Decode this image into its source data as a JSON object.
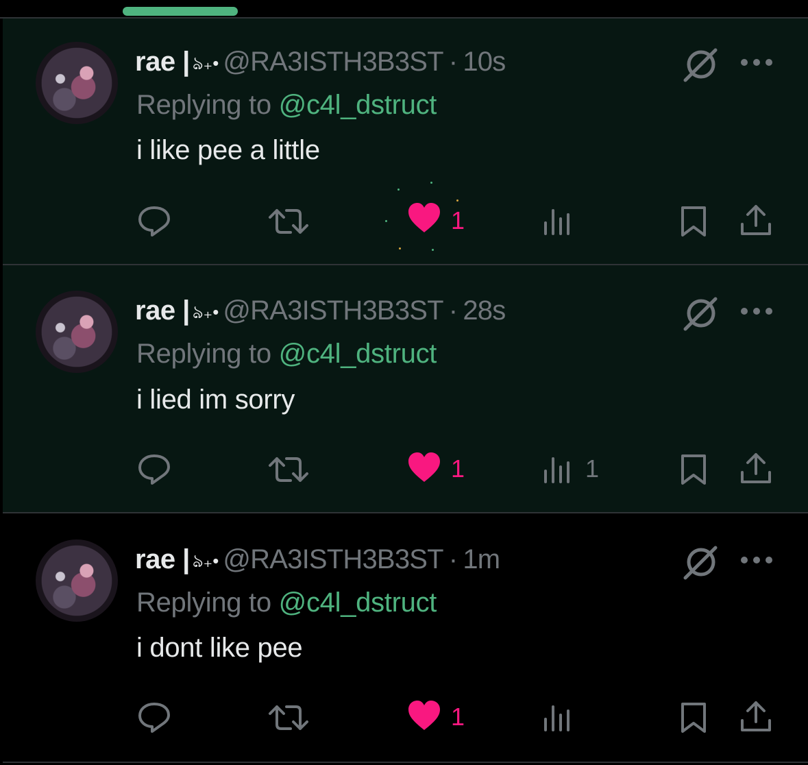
{
  "colors": {
    "accent": "#4fb37f",
    "like": "#f91880",
    "muted": "#71767b",
    "text": "#e7e9ea",
    "highlight_bg": "#071712",
    "divider": "#2f3336"
  },
  "tweets": [
    {
      "display_name": "rae |",
      "name_decoration": "ঌ₊•",
      "handle": "@RA3ISTH3B3ST",
      "separator": "·",
      "time": "10s",
      "replying_prefix": "Replying to",
      "replying_to": "@c4l_dstruct",
      "text": "i like pee a little",
      "likes": "1",
      "views": "",
      "icons": [
        "reply-icon",
        "retweet-icon",
        "heart-icon",
        "views-icon",
        "bookmark-icon",
        "share-icon",
        "grok-icon",
        "more-icon"
      ]
    },
    {
      "display_name": "rae |",
      "name_decoration": "ঌ₊•",
      "handle": "@RA3ISTH3B3ST",
      "separator": "·",
      "time": "28s",
      "replying_prefix": "Replying to",
      "replying_to": "@c4l_dstruct",
      "text": "i lied im sorry",
      "likes": "1",
      "views": "1",
      "icons": [
        "reply-icon",
        "retweet-icon",
        "heart-icon",
        "views-icon",
        "bookmark-icon",
        "share-icon",
        "grok-icon",
        "more-icon"
      ]
    },
    {
      "display_name": "rae |",
      "name_decoration": "ঌ₊•",
      "handle": "@RA3ISTH3B3ST",
      "separator": "·",
      "time": "1m",
      "replying_prefix": "Replying to",
      "replying_to": "@c4l_dstruct",
      "text": "i dont like pee",
      "likes": "1",
      "views": "",
      "icons": [
        "reply-icon",
        "retweet-icon",
        "heart-icon",
        "views-icon",
        "bookmark-icon",
        "share-icon",
        "grok-icon",
        "more-icon"
      ]
    }
  ]
}
